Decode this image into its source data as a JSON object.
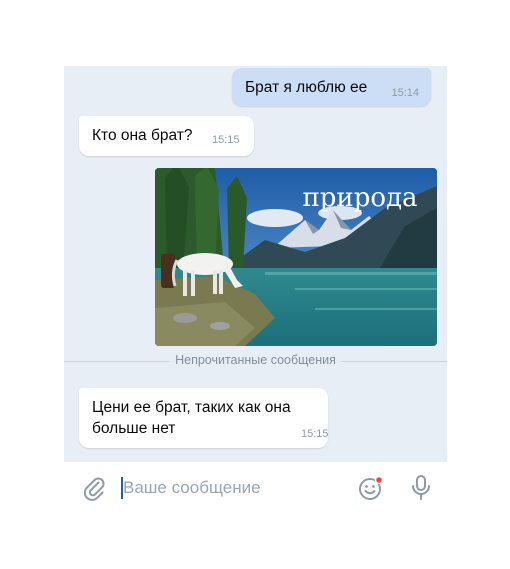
{
  "messages": [
    {
      "direction": "out",
      "text": "Брат я люблю ее",
      "time": "15:14"
    },
    {
      "direction": "in",
      "text": "Кто она брат?",
      "time": "15:15"
    },
    {
      "direction": "in",
      "type": "image",
      "caption_overlay": "природа",
      "subject": "white horse drinking at mountain lake"
    },
    {
      "direction": "in",
      "text": "Цени ее брат, таких как она больше нет",
      "time": "15:15"
    }
  ],
  "divider": {
    "label": "Непрочитанные сообщения"
  },
  "composer": {
    "placeholder": "Ваше сообщение"
  },
  "icons": {
    "attach": "paperclip-icon",
    "emoji": "smiley-icon",
    "mic": "microphone-icon"
  },
  "colors": {
    "chat_background": "#e8eef5",
    "outgoing_bubble": "#ccdef5",
    "incoming_bubble": "#ffffff",
    "time_text": "#8e9cac",
    "icon_gray": "#8f9aa7",
    "notification_dot": "#e64646"
  }
}
